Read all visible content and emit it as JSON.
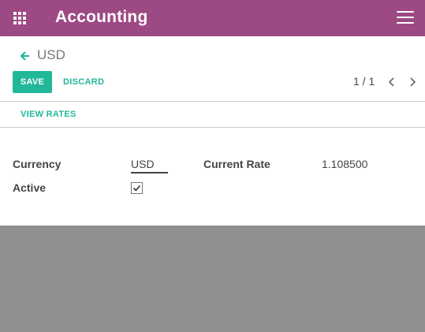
{
  "topbar": {
    "app_title": "Accounting",
    "apps_icon": "grid-icon",
    "menu_icon": "hamburger-menu-icon",
    "color": "#9d4983"
  },
  "breadcrumb": {
    "back_icon": "arrow-left-icon",
    "current": "USD"
  },
  "toolbar": {
    "save_label": "SAVE",
    "discard_label": "DISCARD",
    "accent_color": "#21b799"
  },
  "pager": {
    "value": "1 / 1",
    "prev_icon": "chevron-left-icon",
    "next_icon": "chevron-right-icon"
  },
  "button_box": {
    "view_rates_label": "VIEW RATES"
  },
  "form": {
    "currency_label": "Currency",
    "currency_value": "USD",
    "active_label": "Active",
    "active_checked": true,
    "current_rate_label": "Current Rate",
    "current_rate_value": "1.108500"
  }
}
